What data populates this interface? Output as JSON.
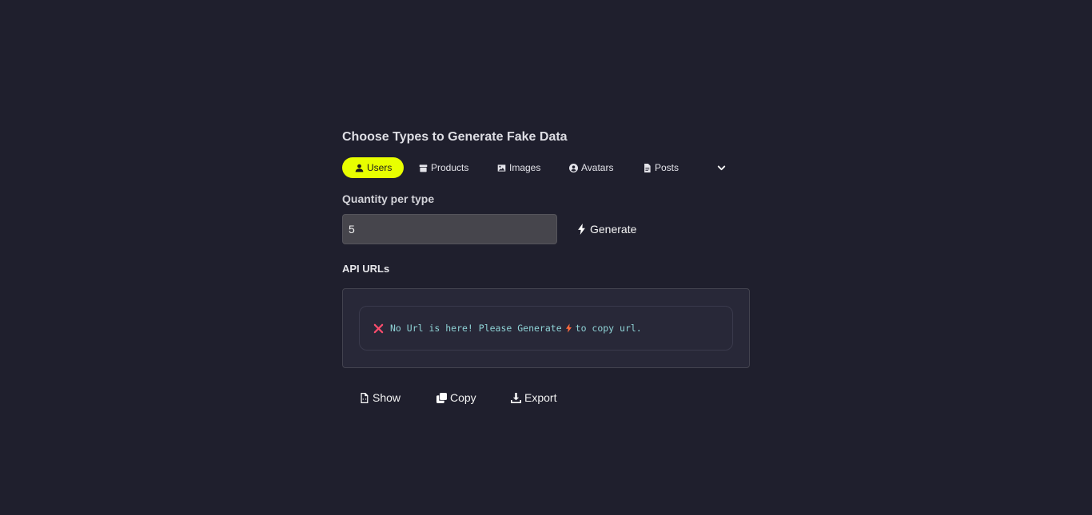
{
  "heading": "Choose Types to Generate Fake Data",
  "types": [
    {
      "label": "Users",
      "icon": "user-icon",
      "active": true
    },
    {
      "label": "Products",
      "icon": "box-icon",
      "active": false
    },
    {
      "label": "Images",
      "icon": "image-icon",
      "active": false
    },
    {
      "label": "Avatars",
      "icon": "avatar-icon",
      "active": false
    },
    {
      "label": "Posts",
      "icon": "file-icon",
      "active": false
    }
  ],
  "more_icon": "chevron-down-icon",
  "quantity": {
    "label": "Quantity per type",
    "value": "5"
  },
  "generate_label": "Generate",
  "api": {
    "label": "API URLs",
    "empty_text_before": "No Url is here! Please Generate",
    "empty_text_after": "to copy url."
  },
  "actions": {
    "show": "Show",
    "copy": "Copy",
    "export": "Export"
  },
  "colors": {
    "background": "#1f1f2d",
    "accent": "#e8ff00",
    "url_text": "#8fd3d6",
    "error": "#ff4d6d",
    "bolt": "#ff6a3d"
  }
}
